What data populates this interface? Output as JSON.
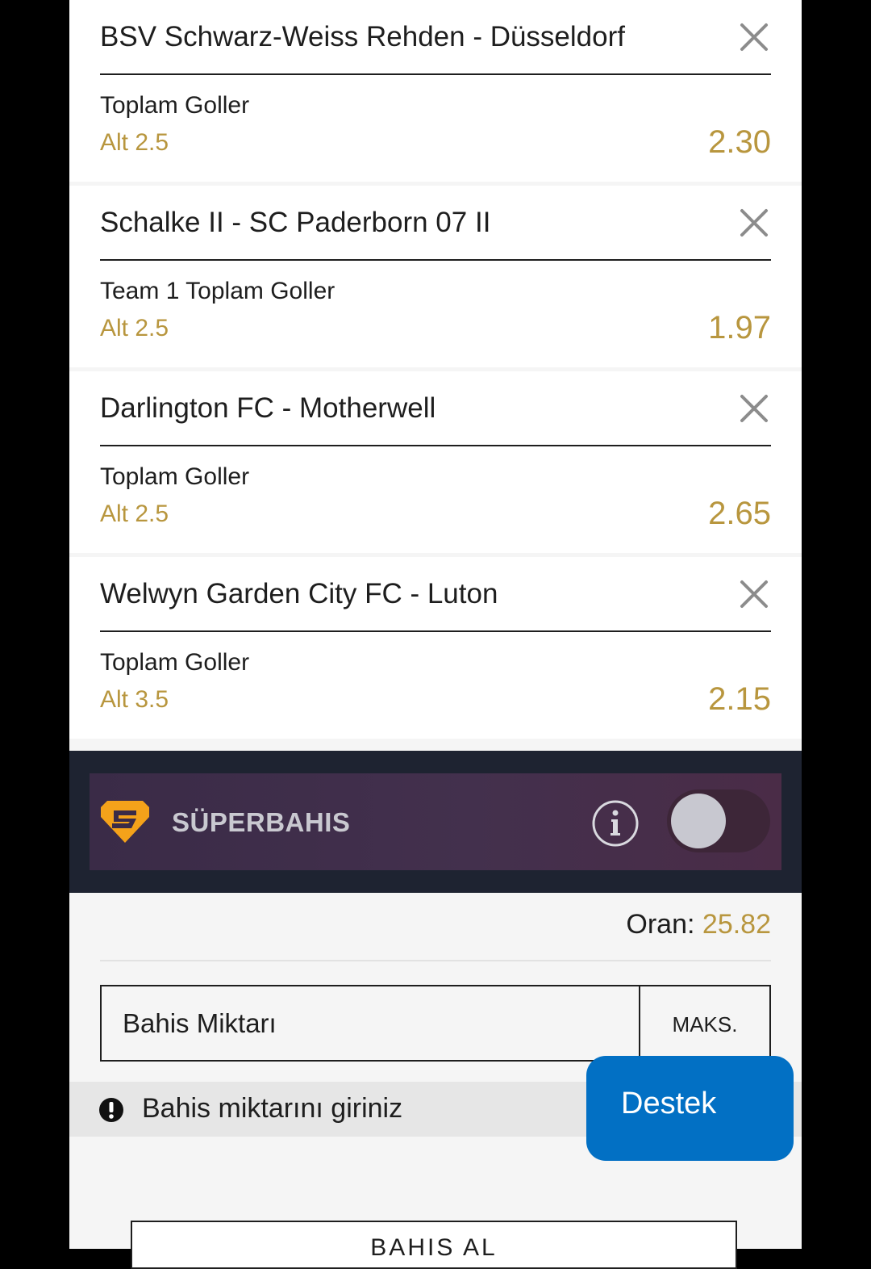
{
  "bets": [
    {
      "match": "BSV Schwarz-Weiss Rehden - Düsseldorf",
      "market": "Toplam Goller",
      "selection": "Alt 2.5",
      "odd": "2.30"
    },
    {
      "match": "Schalke II - SC Paderborn 07 II",
      "market": "Team 1 Toplam Goller",
      "selection": "Alt 2.5",
      "odd": "1.97"
    },
    {
      "match": "Darlington FC - Motherwell",
      "market": "Toplam Goller",
      "selection": "Alt 2.5",
      "odd": "2.65"
    },
    {
      "match": "Welwyn Garden City FC - Luton",
      "market": "Toplam Goller",
      "selection": "Alt 3.5",
      "odd": "2.15"
    }
  ],
  "superbahis": {
    "label": "SÜPERBAHIS",
    "enabled": false,
    "info_icon": "info-icon",
    "logo_icon": "superbahis-logo-icon"
  },
  "summary": {
    "odds_label": "Oran:",
    "odds_value": "25.82"
  },
  "stake": {
    "placeholder": "Bahis Miktarı",
    "value": "",
    "max_label": "MAKS."
  },
  "warning": {
    "icon": "exclamation-circle-icon",
    "text": "Bahis miktarını giriniz"
  },
  "support": {
    "label": "Destek"
  },
  "place_bet": {
    "label": "BAHIS AL"
  },
  "colors": {
    "accent_gold": "#b8963e",
    "support_blue": "#0270c4",
    "dark_band": "#1e2331",
    "super_bar": "#43304d"
  }
}
